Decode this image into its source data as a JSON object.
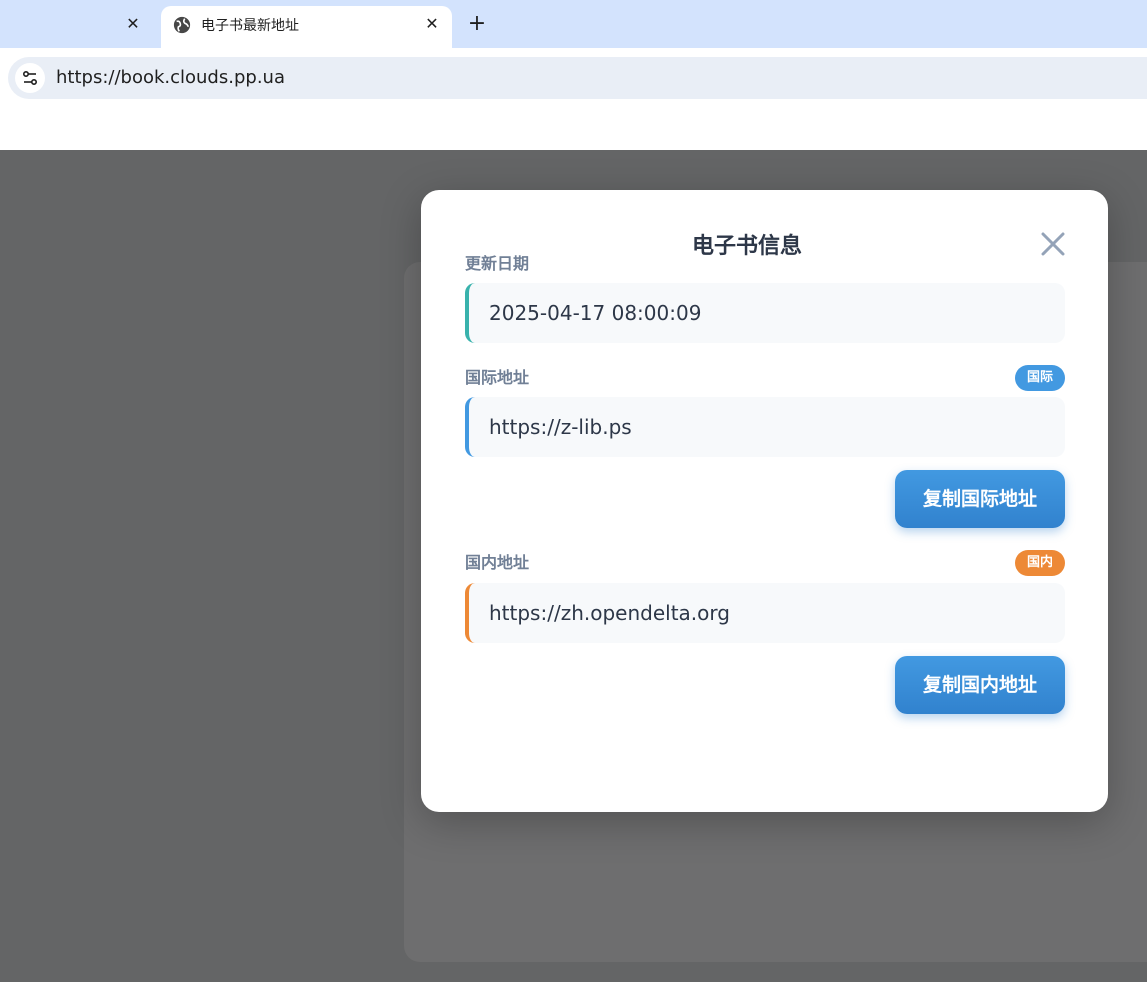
{
  "browser": {
    "tabs": [
      {
        "title": "",
        "active": false
      },
      {
        "title": "电子书最新地址",
        "active": true
      }
    ],
    "url": "https://book.clouds.pp.ua"
  },
  "modal": {
    "title": "电子书信息",
    "fields": [
      {
        "label": "更新日期",
        "value": "2025-04-17 08:00:09",
        "accent": "#38b2ac"
      },
      {
        "label": "国际地址",
        "value": "https://z-lib.ps",
        "tag": "国际",
        "accent": "#4299e1",
        "button": "复制国际地址"
      },
      {
        "label": "国内地址",
        "value": "https://zh.opendelta.org",
        "tag": "国内",
        "accent": "#ed8936",
        "button": "复制国内地址"
      }
    ]
  },
  "colors": {
    "tabbar": "#d3e3fd",
    "omnibox": "#e9eef6",
    "overlay": "#646566",
    "title_text": "#2d3748",
    "label_text": "#718096",
    "primary_button": "#3182ce"
  },
  "icons": {
    "tab_close": "close-icon",
    "favicon": "globe-icon",
    "new_tab": "plus-icon",
    "site_info": "tune-icon",
    "modal_close": "close-icon"
  }
}
